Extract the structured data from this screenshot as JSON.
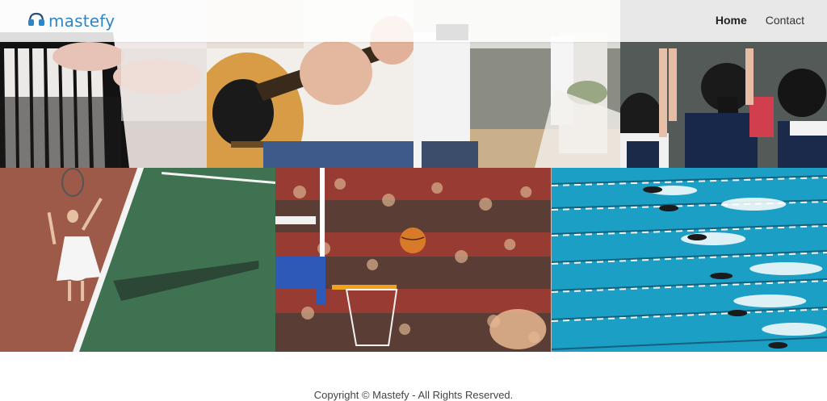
{
  "brand": {
    "name": "mastefy",
    "icon": "headphones-logo-icon",
    "color": "#2f86c4"
  },
  "nav": {
    "items": [
      {
        "label": "Home",
        "active": true
      },
      {
        "label": "Contact",
        "active": false
      }
    ]
  },
  "gallery": {
    "row1": [
      {
        "subject": "piano"
      },
      {
        "subject": "guitar"
      },
      {
        "subject": "photographer-wedding"
      },
      {
        "subject": "classroom-chalkboard"
      }
    ],
    "row2": [
      {
        "subject": "tennis"
      },
      {
        "subject": "basketball"
      },
      {
        "subject": "swimming"
      }
    ]
  },
  "footer": {
    "text": "Copyright © Mastefy - All Rights Reserved."
  }
}
